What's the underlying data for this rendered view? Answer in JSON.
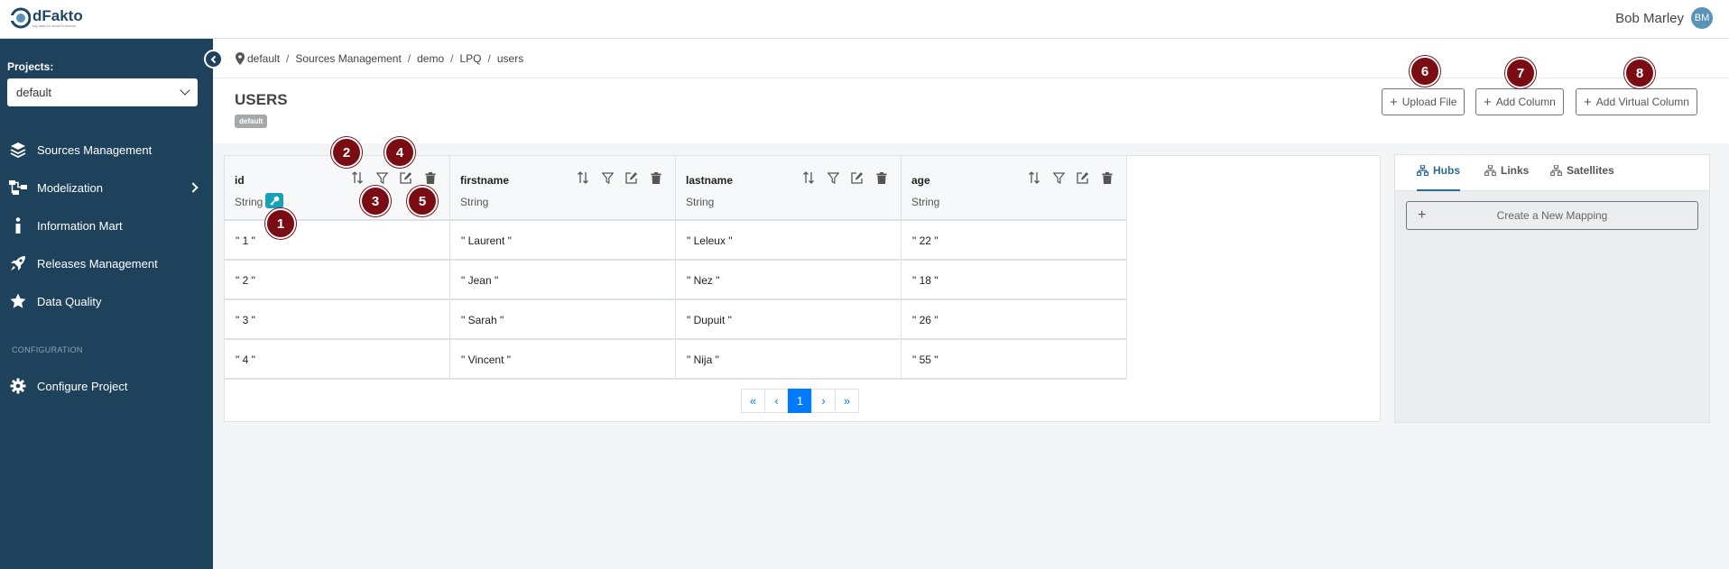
{
  "app": {
    "logo_name": "dFakto",
    "logo_tagline": "big data for smart business"
  },
  "user": {
    "name": "Bob Marley",
    "initials": "BM"
  },
  "sidebar": {
    "projects_label": "Projects:",
    "project_selected": "default",
    "items": [
      {
        "label": "Sources Management",
        "icon": "layers-icon"
      },
      {
        "label": "Modelization",
        "icon": "diagram-icon"
      },
      {
        "label": "Information Mart",
        "icon": "info-icon"
      },
      {
        "label": "Releases Management",
        "icon": "rocket-icon"
      },
      {
        "label": "Data Quality",
        "icon": "star-icon"
      }
    ],
    "config_label": "CONFIGURATION",
    "config_item": "Configure Project"
  },
  "breadcrumb": [
    "default",
    "Sources Management",
    "demo",
    "LPQ",
    "users"
  ],
  "page": {
    "title": "USERS",
    "badge": "default",
    "buttons": {
      "upload": "Upload File",
      "add_column": "Add Column",
      "add_virtual": "Add Virtual Column"
    }
  },
  "table": {
    "columns": [
      {
        "name": "id",
        "type": "String"
      },
      {
        "name": "firstname",
        "type": "String"
      },
      {
        "name": "lastname",
        "type": "String"
      },
      {
        "name": "age",
        "type": "String"
      }
    ],
    "rows": [
      [
        "\" 1 \"",
        "\" Laurent \"",
        "\" Leleux \"",
        "\" 22 \""
      ],
      [
        "\" 2 \"",
        "\" Jean \"",
        "\" Nez \"",
        "\" 18 \""
      ],
      [
        "\" 3 \"",
        "\" Sarah \"",
        "\" Dupuit \"",
        "\" 26 \""
      ],
      [
        "\" 4 \"",
        "\" Vincent \"",
        "\" Nija \"",
        "\" 55 \""
      ]
    ],
    "pagination": {
      "first": "«",
      "prev": "‹",
      "current": "1",
      "next": "›",
      "last": "»"
    }
  },
  "right_panel": {
    "tabs": [
      "Hubs",
      "Links",
      "Satellites"
    ],
    "active_tab": "Hubs",
    "create_mapping": "Create a New Mapping"
  },
  "markers": [
    "1",
    "2",
    "3",
    "4",
    "5",
    "6",
    "7",
    "8"
  ],
  "colors": {
    "sidebar": "#1e425c",
    "primary": "#007bff",
    "marker": "#7a0d14",
    "key_button": "#17a2b8"
  }
}
